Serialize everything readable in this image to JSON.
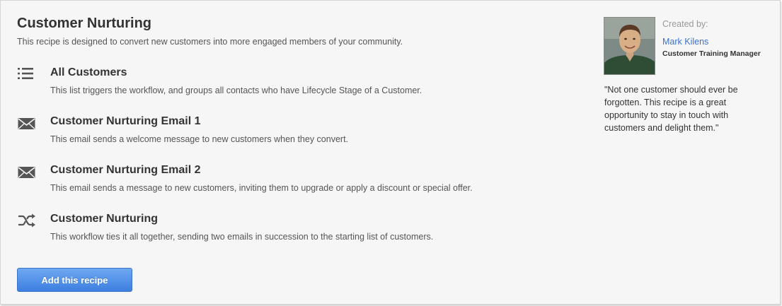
{
  "recipe": {
    "title": "Customer Nurturing",
    "description": "This recipe is designed to convert new customers into more engaged members of your community."
  },
  "steps": [
    {
      "icon": "list-icon",
      "title": "All Customers",
      "description": "This list triggers the workflow, and groups all contacts who have Lifecycle Stage of a Customer."
    },
    {
      "icon": "envelope-icon",
      "title": "Customer Nurturing Email 1",
      "description": "This email sends a welcome message to new customers when they convert."
    },
    {
      "icon": "envelope-icon",
      "title": "Customer Nurturing Email 2",
      "description": "This email sends a message to new customers, inviting them to upgrade or apply a discount or special offer."
    },
    {
      "icon": "shuffle-icon",
      "title": "Customer Nurturing",
      "description": "This workflow ties it all together, sending two emails in succession to the starting list of customers."
    }
  ],
  "actions": {
    "add_label": "Add this recipe"
  },
  "author": {
    "created_label": "Created by:",
    "name": "Mark Kilens",
    "role": "Customer Training Manager",
    "quote": "\"Not one customer should ever be forgotten. This recipe is a great opportunity to stay in touch with customers and delight them.\""
  },
  "colors": {
    "accent": "#3d7fe0",
    "link": "#3b73c8",
    "icon": "#555555"
  }
}
